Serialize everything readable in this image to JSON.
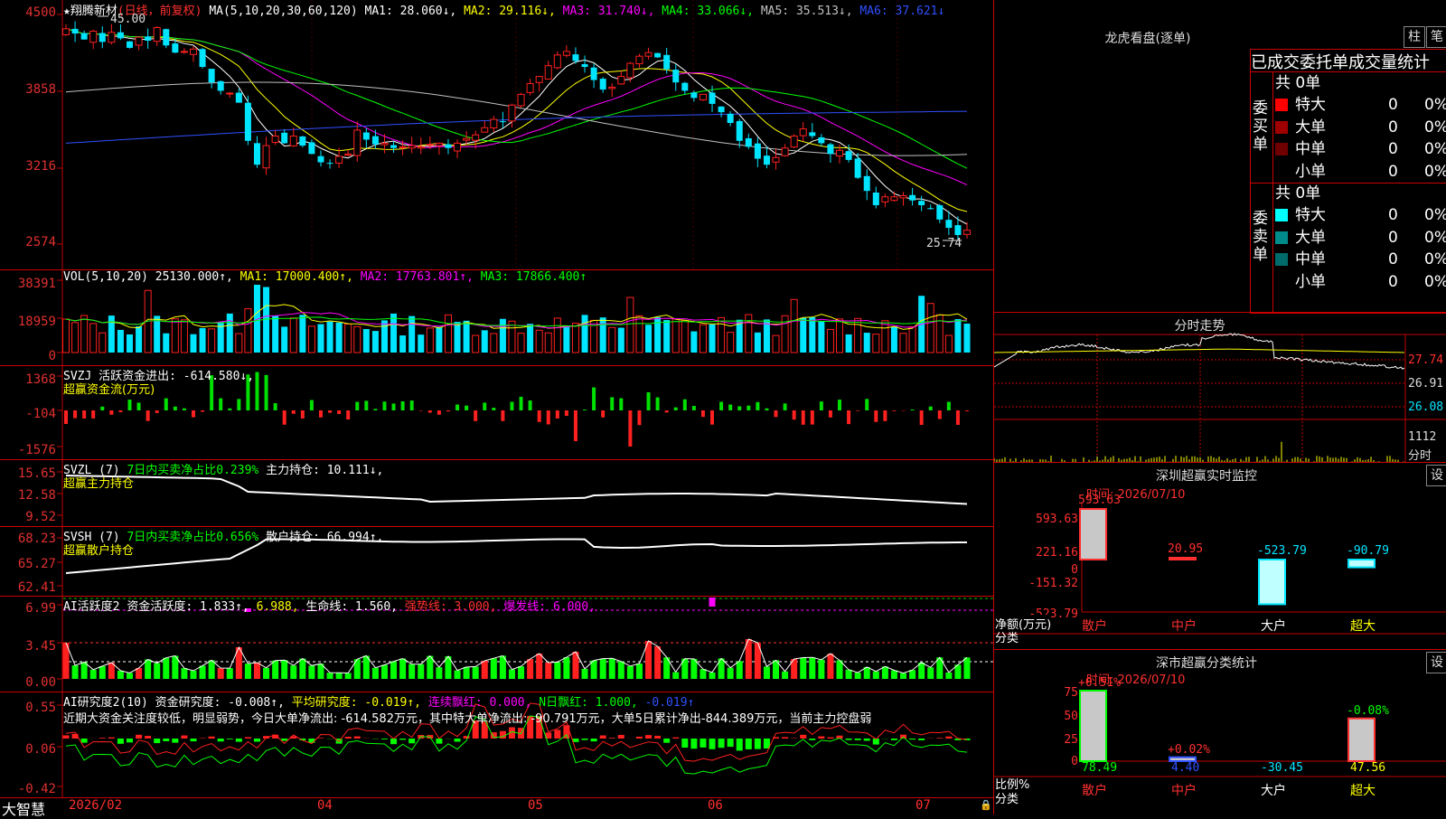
{
  "colors": {
    "up": "#ff2020",
    "down": "#00e5ff",
    "ma1": "#ffffff",
    "ma2": "#ffff00",
    "ma3": "#ff00ff",
    "ma4": "#00ff00",
    "ma5": "#c0c0c0",
    "ma6": "#3050ff",
    "grid": "#c00000"
  },
  "main": {
    "title_stock": "★翔腾新材",
    "title_period": "(日线，前复权)",
    "ma_params": "MA(5,10,20,30,60,120)",
    "ma1": "MA1: 28.060↓,",
    "ma2": "MA2: 29.116↓,",
    "ma3": "MA3: 31.740↓,",
    "ma4": "MA4: 33.066↓,",
    "ma5": "MA5: 35.513↓,",
    "ma6": "MA6: 37.621↓",
    "y_labels": [
      "4500",
      "3858",
      "3216",
      "2574"
    ],
    "high_mark": "45.00",
    "low_mark": "25.74"
  },
  "vol": {
    "title": "VOL(5,10,20)",
    "value": "25130.000↑,",
    "ma1": "MA1: 17000.400↑,",
    "ma2": "MA2: 17763.801↑,",
    "ma3": "MA3: 17866.400↑",
    "y_labels": [
      "38391",
      "18959",
      "0"
    ]
  },
  "svzj": {
    "title": "SVZJ",
    "label": "活跃资金进出: -614.580↓,",
    "sub": "超赢资金流(万元)",
    "y_labels": [
      "1368",
      "-104",
      "-1576"
    ]
  },
  "svzl": {
    "title": "SVZL (7)",
    "part1": "7日内买卖净占比0.239%",
    "part2": "主力持仓: 10.111↓,",
    "sub": "超赢主力持仓",
    "y_labels": [
      "15.65",
      "12.58",
      "9.52"
    ]
  },
  "svsh": {
    "title": "SVSH (7)",
    "part1": "7日内买卖净占比0.656%",
    "part2": "散户持仓: 66.994↑,",
    "sub": "超赢散户持仓",
    "y_labels": [
      "68.23",
      "65.27",
      "62.41"
    ]
  },
  "ai1": {
    "title": "AI活跃度2",
    "p1": "资金活跃度: 1.833↑,",
    "p2": "6.988,",
    "p3": "生命线: 1.560,",
    "p4": "强势线: 3.000,",
    "p5": "爆发线: 6.000,",
    "y_labels": [
      "6.99",
      "3.45",
      "0.00"
    ]
  },
  "ai2": {
    "title": "AI研究度2(10)",
    "p1": "资金研究度: -0.008↑,",
    "p2": "平均研究度: -0.019↑,",
    "p3": "连续飘红: 0.000,",
    "p4": "N日飘红: 1.000,",
    "p5": "-0.019↑",
    "text": "近期大资金关注度较低，明显弱势，今日大单净流出: -614.582万元，其中特大单净流出: -90.791万元，大单5日累计净出-844.389万元，当前主力控盘弱",
    "y_labels": [
      "0.55",
      "0.06",
      "-0.42"
    ]
  },
  "bottom": {
    "brand": "大智慧",
    "dates": [
      "2026/02",
      "04",
      "05",
      "06",
      "07"
    ]
  },
  "lh": {
    "title": "龙虎看盘(逐单)",
    "btn1": "柱",
    "btn2": "笔",
    "tabs": "已成交委托单成交量统计",
    "buy_label": "委买单",
    "sell_label": "委卖单",
    "buy_total": "共 0单",
    "sell_total": "共 0单",
    "buy_rows": [
      {
        "name": "特大",
        "n": "0",
        "p": "0%",
        "c": "#ff0000"
      },
      {
        "name": "大单",
        "n": "0",
        "p": "0%",
        "c": "#a00000"
      },
      {
        "name": "中单",
        "n": "0",
        "p": "0%",
        "c": "#700000"
      },
      {
        "name": "小单",
        "n": "0",
        "p": "0%",
        "c": "#000000"
      }
    ],
    "sell_rows": [
      {
        "name": "特大",
        "n": "0",
        "p": "0%",
        "c": "#00ffff"
      },
      {
        "name": "大单",
        "n": "0",
        "p": "0%",
        "c": "#008b8b"
      },
      {
        "name": "中单",
        "n": "0",
        "p": "0%",
        "c": "#006b6b"
      },
      {
        "name": "小单",
        "n": "0",
        "p": "0%",
        "c": "#000000"
      }
    ]
  },
  "fs": {
    "title": "分时走势",
    "y1": "27.74",
    "y2": "26.91",
    "y3": "26.08",
    "vol": "1112",
    "vol_label": "分时"
  },
  "sz": {
    "title": "深圳超赢实时监控",
    "btn": "设",
    "time": "时间: 2026/07/10",
    "y_labels": [
      "593.63",
      "221.16",
      "0",
      "-151.32",
      "-523.79"
    ],
    "y_title1": "净额(万元)",
    "y_title2": "分类",
    "cats": [
      "散户",
      "中户",
      "大户",
      "超大"
    ],
    "values": [
      593.63,
      20.95,
      -523.79,
      -90.79
    ],
    "value_labels": [
      "593.63",
      "20.95",
      "-523.79",
      "-90.79"
    ]
  },
  "ss": {
    "title": "深市超赢分类统计",
    "btn": "设",
    "time": "时间: 2026/07/10",
    "y_labels": [
      "75",
      "50",
      "25",
      "0"
    ],
    "y_title1": "比例%",
    "y_title2": "分类",
    "cats": [
      "散户",
      "中户",
      "大户",
      "超大"
    ],
    "top_labels": [
      "+0.51%",
      "+0.02%",
      "",
      "-0.08%"
    ],
    "values": [
      "78.49",
      "4.40",
      "-30.45",
      "47.56"
    ]
  }
}
